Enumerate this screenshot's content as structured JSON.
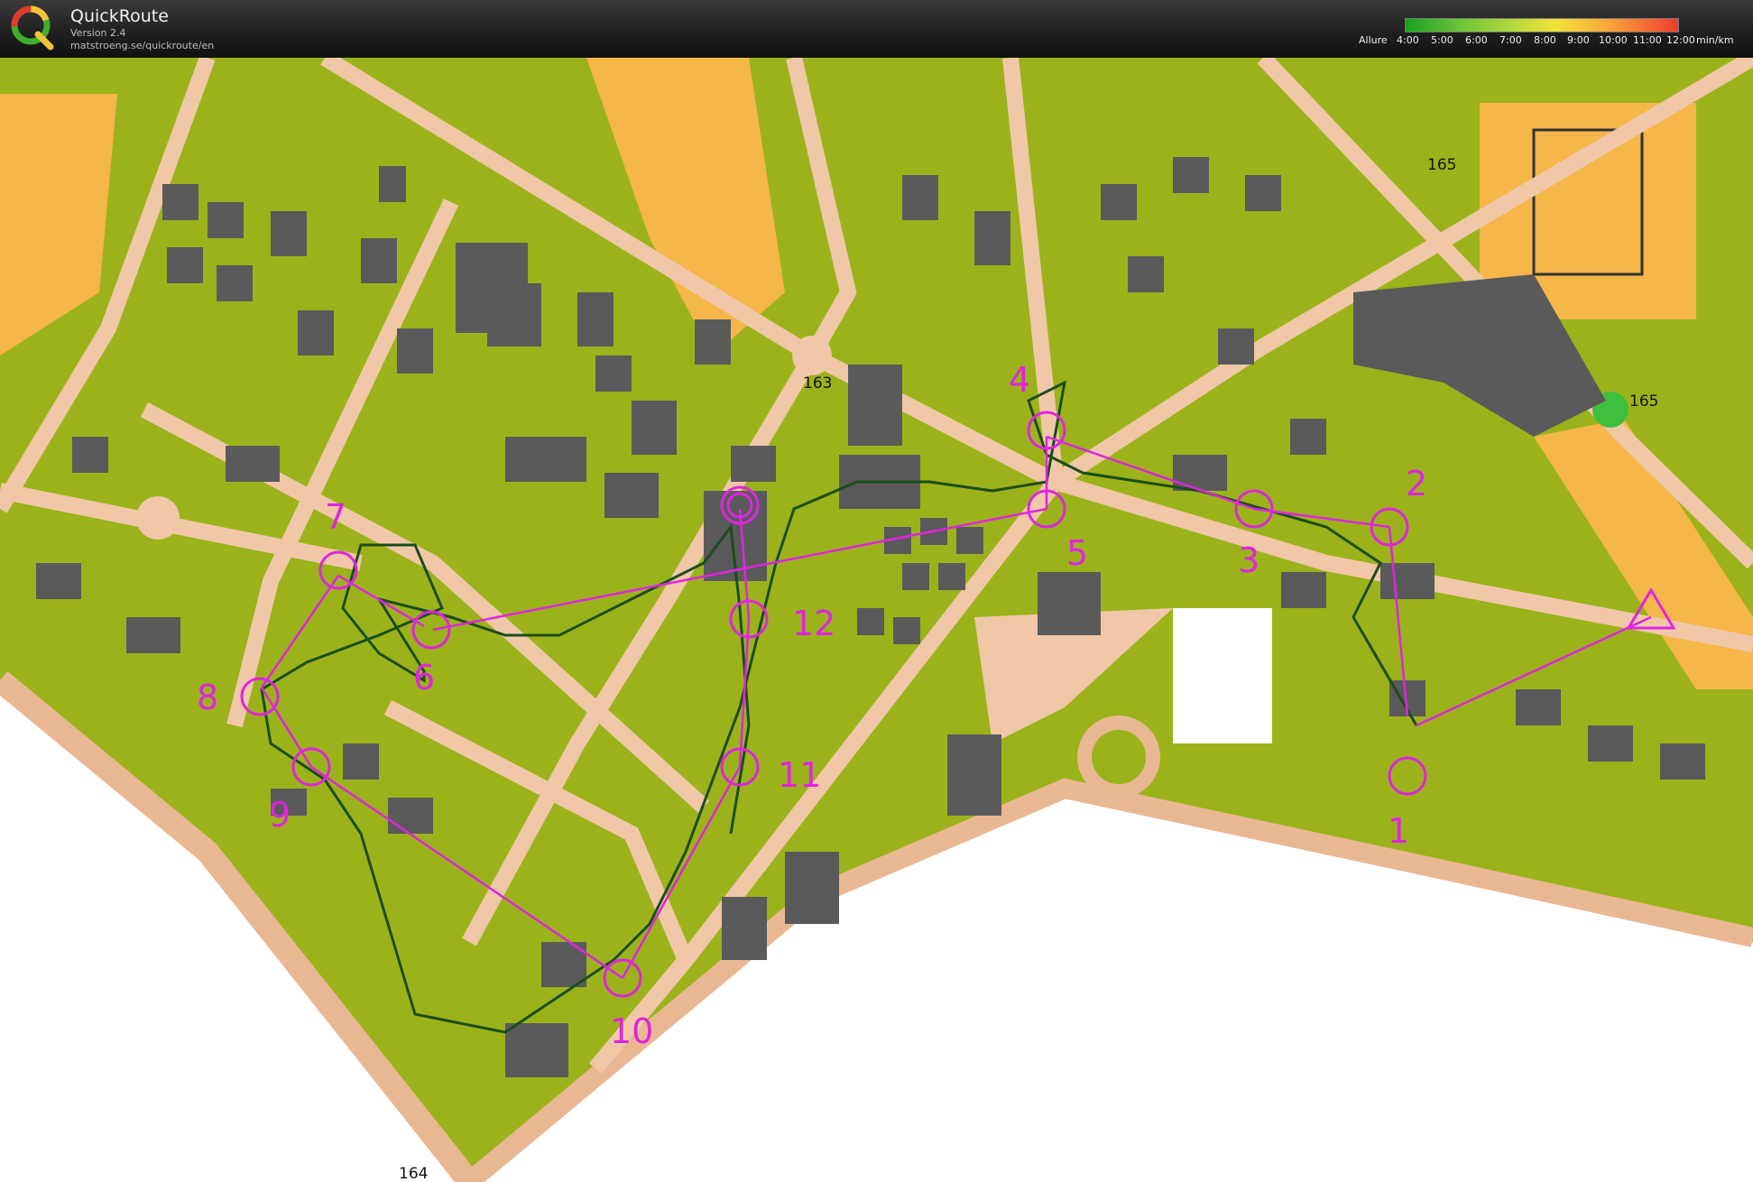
{
  "app": {
    "title": "QuickRoute",
    "version": "Version 2.4",
    "url": "matstroeng.se/quickroute/en"
  },
  "legend": {
    "label": "Allure",
    "ticks": [
      "4:00",
      "5:00",
      "6:00",
      "7:00",
      "8:00",
      "9:00",
      "10:00",
      "11:00",
      "12:00"
    ],
    "unit": "min/km",
    "colors": [
      "#19a11f",
      "#6cc43a",
      "#b6d93c",
      "#f2e23c",
      "#f7a43a",
      "#ee3d2c"
    ]
  },
  "map": {
    "controls": [
      "1",
      "2",
      "3",
      "4",
      "5",
      "6",
      "7",
      "8",
      "9",
      "10",
      "11",
      "12"
    ],
    "road_numbers": [
      "163",
      "164",
      "165",
      "165"
    ],
    "colors": {
      "open_land": "#f5b64a",
      "forest": "#9cb21a",
      "paved": "#f0c8a8",
      "building": "#5a5a5a",
      "course": "#e024e0",
      "route": "#1b4d1b",
      "water_white": "#ffffff"
    }
  }
}
